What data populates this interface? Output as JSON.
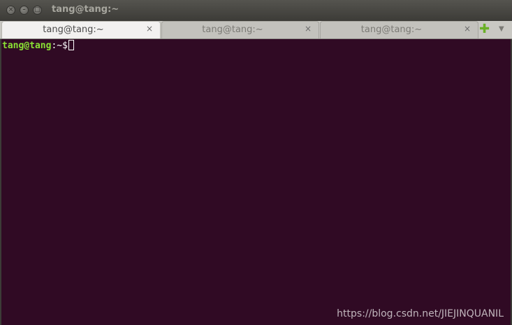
{
  "window": {
    "title": "tang@tang:~",
    "controls": {
      "close_glyph": "×",
      "minimize_glyph": "–",
      "maximize_glyph": "□"
    }
  },
  "tabs": [
    {
      "label": "tang@tang:~",
      "close": "×",
      "active": true
    },
    {
      "label": "tang@tang:~",
      "close": "×",
      "active": false
    },
    {
      "label": "tang@tang:~",
      "close": "×",
      "active": false
    }
  ],
  "tabbar": {
    "new_tab_glyph": "✚",
    "menu_glyph": "▼"
  },
  "terminal": {
    "prompt_user": "tang@tang",
    "prompt_sep": ":",
    "prompt_path": "~$",
    "background": "#300a24",
    "prompt_color": "#8ae234"
  },
  "watermark": "https://blog.csdn.net/JIEJINQUANIL"
}
